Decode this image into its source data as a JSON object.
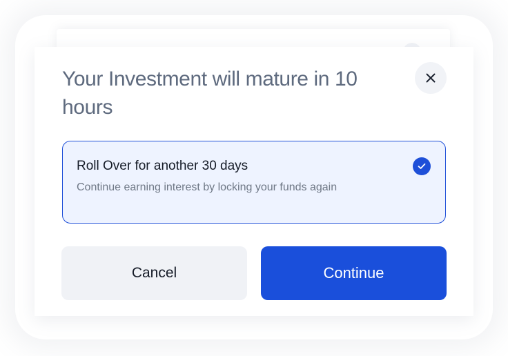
{
  "modal": {
    "title": "Your Investment will mature in 10 hours",
    "close_icon": "close-icon"
  },
  "option": {
    "title": "Roll Over for another 30 days",
    "description": "Continue earning interest by locking your funds again",
    "selected": true,
    "check_icon": "checkmark-icon"
  },
  "actions": {
    "cancel_label": "Cancel",
    "continue_label": "Continue"
  },
  "colors": {
    "accent": "#1a4fdb",
    "title_text": "#5e6a7e",
    "option_background": "#eef3ff",
    "cancel_background": "#f0f2f6"
  }
}
